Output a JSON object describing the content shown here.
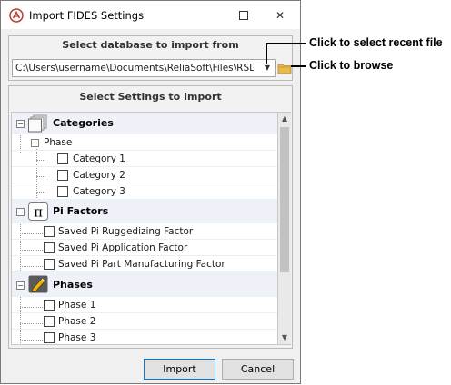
{
  "window": {
    "title": "Import FIDES Settings",
    "app_icon": "reliasoft-logo-icon",
    "maximize_icon": "maximize-icon",
    "close_icon": "close-icon",
    "close_glyph": "✕"
  },
  "database": {
    "heading": "Select database to import from",
    "path": "C:\\Users\\username\\Documents\\ReliaSoft\\Files\\RSD...",
    "dropdown_icon": "chevron-down-icon",
    "dropdown_glyph": "▼",
    "browse_icon": "folder-icon"
  },
  "settings": {
    "heading": "Select Settings to Import",
    "groups": [
      {
        "label": "Categories",
        "icon": "categories-icon",
        "expanded": true,
        "subgroup": {
          "label": "Phase",
          "expanded": true,
          "items": [
            {
              "label": "Category 1",
              "checked": false
            },
            {
              "label": "Category 2",
              "checked": false
            },
            {
              "label": "Category 3",
              "checked": false
            }
          ]
        }
      },
      {
        "label": "Pi Factors",
        "icon": "pi-icon",
        "expanded": true,
        "items": [
          {
            "label": "Saved Pi Ruggedizing Factor",
            "checked": false
          },
          {
            "label": "Saved Pi Application Factor",
            "checked": false
          },
          {
            "label": "Saved Pi Part Manufacturing Factor",
            "checked": false
          }
        ]
      },
      {
        "label": "Phases",
        "icon": "pencil-icon",
        "expanded": true,
        "items": [
          {
            "label": "Phase 1",
            "checked": false
          },
          {
            "label": "Phase 2",
            "checked": false
          },
          {
            "label": "Phase 3",
            "checked": false
          }
        ]
      }
    ],
    "toggle_glyph": "−",
    "scroll_up_glyph": "▲",
    "scroll_down_glyph": "▼"
  },
  "buttons": {
    "import": "Import",
    "cancel": "Cancel"
  },
  "callouts": {
    "recent_file": "Click to select recent file",
    "browse": "Click to browse"
  },
  "colors": {
    "group_row_bg": "#eef2f8",
    "accent_border": "#0078d7",
    "folder": "#d9a441"
  }
}
